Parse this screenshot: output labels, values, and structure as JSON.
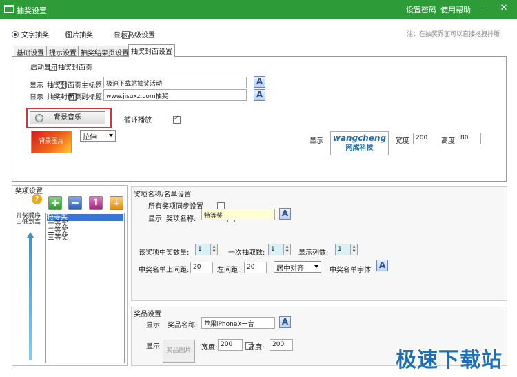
{
  "window": {
    "title": "抽奖设置",
    "link_password": "设置密码",
    "link_help": "使用帮助",
    "min": "—",
    "close": "✕"
  },
  "mode": {
    "text_label": "文字抽奖",
    "image_label": "图片抽奖",
    "advanced_label": "显示高级设置",
    "note": "注：在抽奖界面可以直接拖拽排版"
  },
  "tabs": [
    "基础设置",
    "提示设置",
    "抽奖结果页设置",
    "抽奖封面设置"
  ],
  "cover": {
    "enable_label": "启动显示抽奖封面页",
    "show_label": "显示",
    "main_title_label": "抽奖封面页主标题",
    "main_title_value": "极速下载站抽奖活动",
    "sub_title_label": "抽奖封面页副标题",
    "sub_title_value": "www.jisuxz.com抽奖",
    "font_btn": "A",
    "bg_music_button": "背景音乐",
    "loop_label": "循环播放",
    "bg_image_label": "背景图片",
    "stretch_value": "拉伸",
    "logo_show_label": "显示",
    "logo_text_top": "wangcheng",
    "logo_text_bottom": "网成科技",
    "width_label": "宽度",
    "width_value": "200",
    "height_label": "高度",
    "height_value": "80"
  },
  "prize": {
    "title": "奖项设置",
    "order_label_1": "开奖顺序",
    "order_label_2": "由低到高",
    "items": [
      "特等奖",
      "一等奖",
      "二等奖",
      "三等奖"
    ]
  },
  "name_list": {
    "title": "奖项名称/名单设置",
    "sync_label": "所有奖项同步设置",
    "show_label": "显示",
    "prize_name_label": "奖项名称:",
    "prize_name_value": "特等奖",
    "winners_label": "该奖项中奖数量:",
    "winners_value": "1",
    "draw_once_label": "一次抽取数:",
    "draw_once_value": "1",
    "columns_label": "显示列数:",
    "columns_value": "1",
    "top_margin_label": "中奖名单上间距:",
    "top_margin_value": "20",
    "left_margin_label": "左间距:",
    "left_margin_value": "20",
    "align_value": "居中对齐",
    "font_label": "中奖名单字体"
  },
  "award": {
    "title": "奖品设置",
    "show_label": "显示",
    "name_label": "奖品名称:",
    "name_value": "苹果iPhoneX一台",
    "image_label": "奖品图片",
    "width_label": "宽度:",
    "width_value": "200",
    "height_label": "高度:",
    "height_value": "200"
  },
  "watermark": "极速下载站",
  "colors": {
    "titlebar": "#2c9b38",
    "highlight": "#d9323a",
    "plus": "#2e9a2e",
    "minus": "#2f5fb3",
    "up": "#a0287a",
    "down": "#e48a12"
  }
}
